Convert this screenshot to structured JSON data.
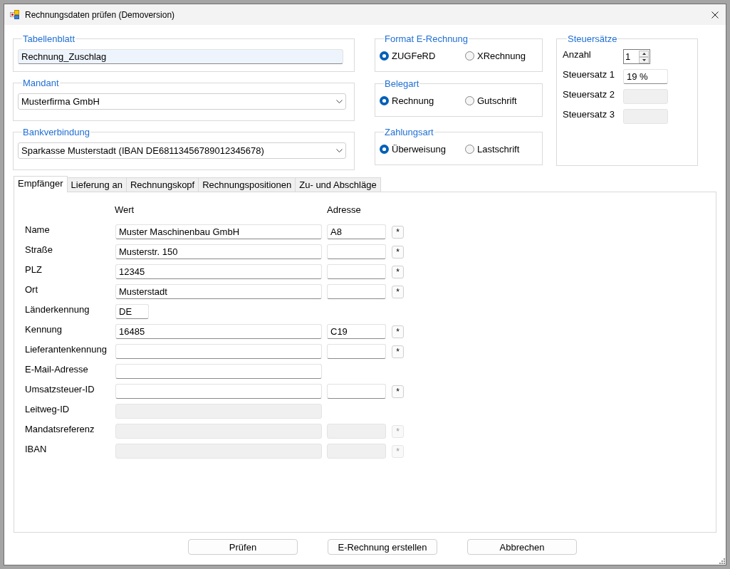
{
  "window": {
    "title": "Rechnungsdaten prüfen (Demoversion)"
  },
  "selection_groups": [
    {
      "kind": "textbox",
      "label": "Tabellenblatt",
      "value": "Rechnung_Zuschlag",
      "focused": true
    },
    {
      "kind": "dropdown",
      "label": "Mandant",
      "value": "Musterfirma GmbH",
      "focused": false
    },
    {
      "kind": "dropdown",
      "label": "Bankverbindung",
      "value": "Sparkasse Musterstadt (IBAN DE68113456789012345678)",
      "focused": false
    }
  ],
  "radio_groups": [
    {
      "label": "Format E-Rechnung",
      "options": [
        {
          "label": "ZUGFeRD",
          "selected": true
        },
        {
          "label": "XRechnung",
          "selected": false
        }
      ]
    },
    {
      "label": "Belegart",
      "options": [
        {
          "label": "Rechnung",
          "selected": true
        },
        {
          "label": "Gutschrift",
          "selected": false
        }
      ]
    },
    {
      "label": "Zahlungsart",
      "options": [
        {
          "label": "Überweisung",
          "selected": true
        },
        {
          "label": "Lastschrift",
          "selected": false
        }
      ]
    }
  ],
  "tax_rates": {
    "label": "Steuersätze",
    "count": {
      "label": "Anzahl",
      "value": "1"
    },
    "rates": [
      {
        "label": "Steuersatz 1",
        "value": "19 %",
        "disabled": false
      },
      {
        "label": "Steuersatz 2",
        "disabled": true
      },
      {
        "label": "Steuersatz 3",
        "disabled": true
      }
    ]
  },
  "tabs": [
    {
      "label": "Empfänger",
      "selected": true
    },
    {
      "label": "Lieferung an",
      "selected": false
    },
    {
      "label": "Rechnungskopf",
      "selected": false
    },
    {
      "label": "Rechnungspositionen",
      "selected": false
    },
    {
      "label": "Zu- und Abschläge",
      "selected": false
    }
  ],
  "recipient": {
    "columns": [
      "Wert",
      "Adresse"
    ],
    "rows": [
      {
        "kind": "full",
        "label": "Name",
        "value": "Muster Maschinenbau GmbH",
        "address": "A8",
        "button": "*",
        "disabled": false
      },
      {
        "kind": "full",
        "label": "Straße",
        "value": "Musterstr. 150",
        "button": "*",
        "disabled": false
      },
      {
        "kind": "full",
        "label": "PLZ",
        "value": "12345",
        "button": "*",
        "disabled": false
      },
      {
        "kind": "full",
        "label": "Ort",
        "value": "Musterstadt",
        "button": "*",
        "disabled": false
      },
      {
        "kind": "short",
        "label": "Länderkennung",
        "value": "DE",
        "disabled": false
      },
      {
        "kind": "full",
        "label": "Kennung",
        "value": "16485",
        "address": "C19",
        "button": "*",
        "disabled": false
      },
      {
        "kind": "full",
        "label": "Lieferantenkennung",
        "button": "*",
        "disabled": false
      },
      {
        "kind": "single",
        "label": "E-Mail-Adresse",
        "disabled": false
      },
      {
        "kind": "full",
        "label": "Umsatzsteuer-ID",
        "button": "*",
        "disabled": false
      },
      {
        "kind": "single",
        "label": "Leitweg-ID",
        "disabled": true
      },
      {
        "kind": "full",
        "label": "Mandatsreferenz",
        "button": "*",
        "disabled": true
      },
      {
        "kind": "full",
        "label": "IBAN",
        "button": "*",
        "disabled": true
      }
    ]
  },
  "buttons": [
    "Prüfen",
    "E-Rechnung erstellen",
    "Abbrechen"
  ]
}
